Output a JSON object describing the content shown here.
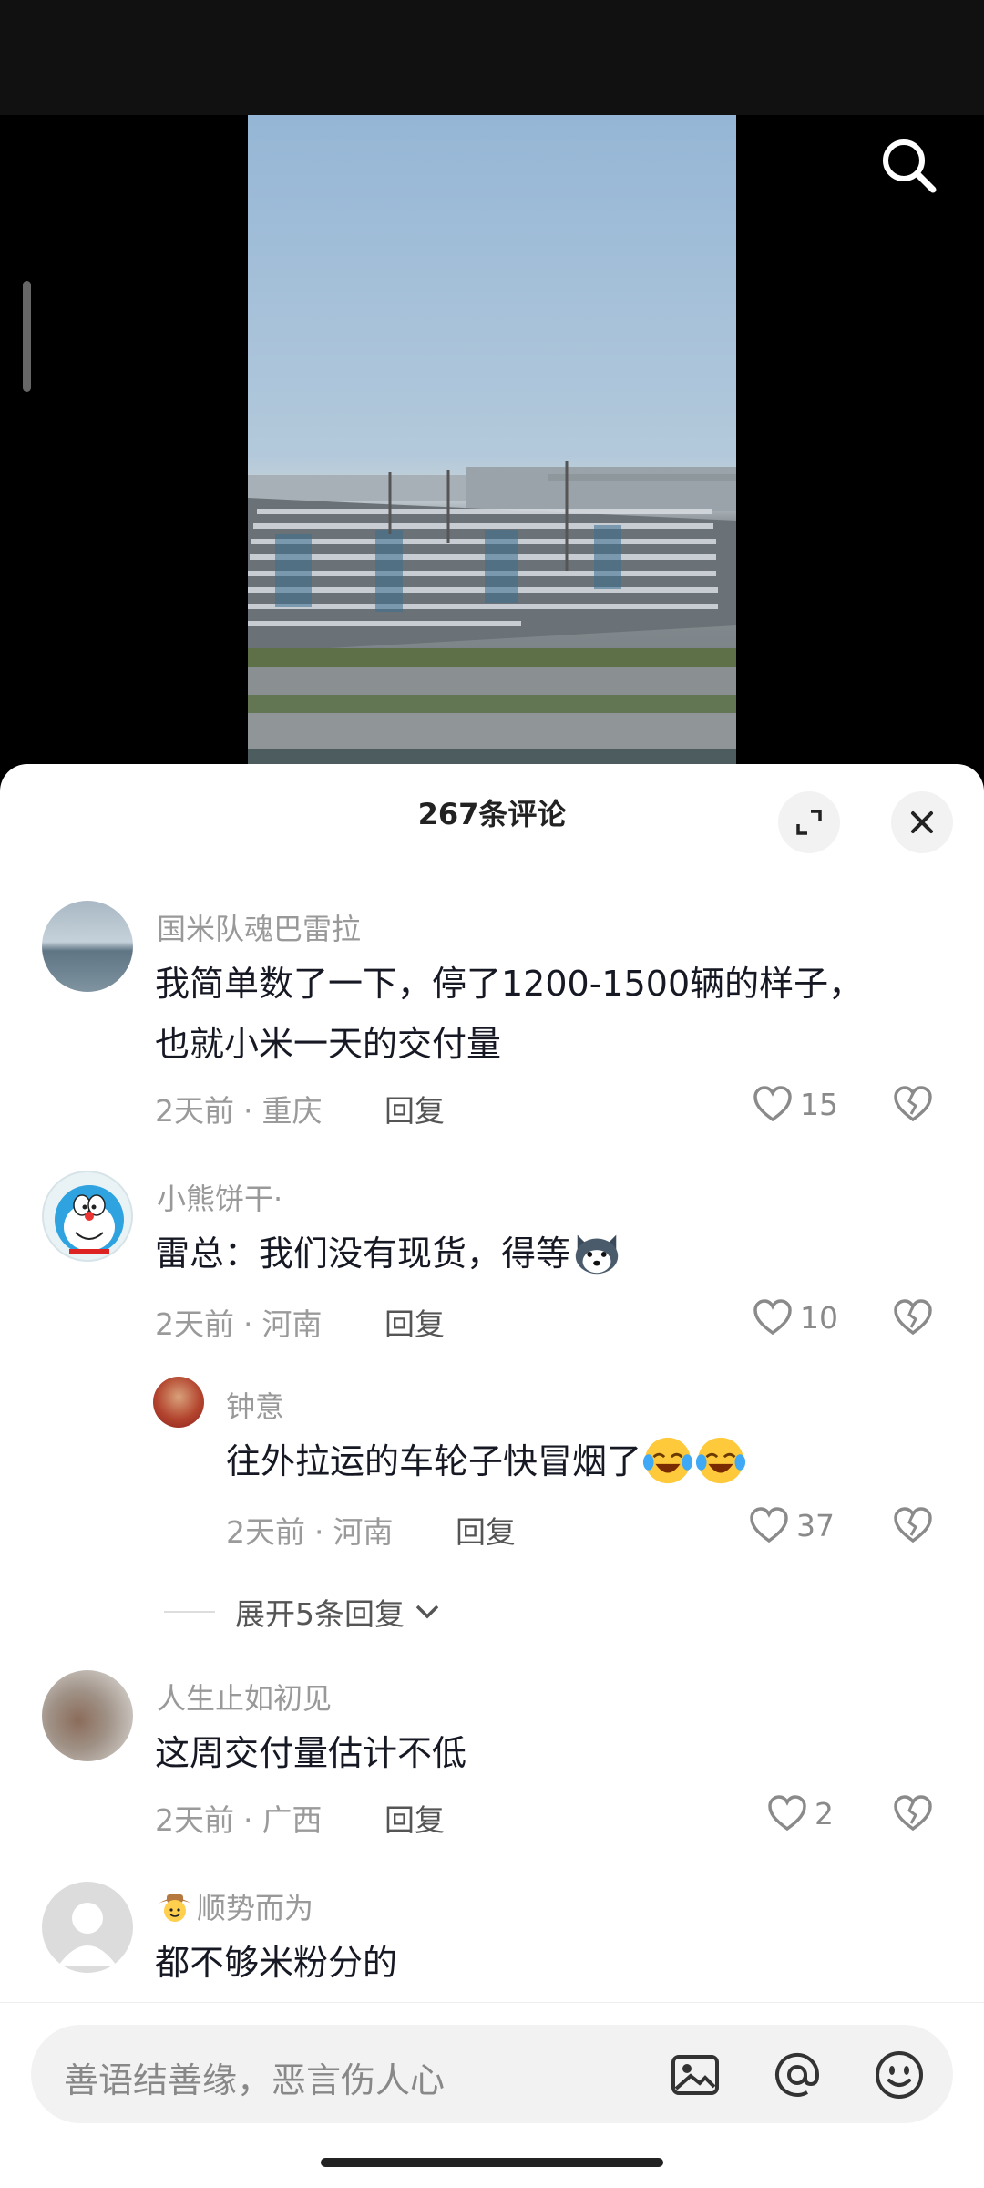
{
  "sheet": {
    "title": "267条评论"
  },
  "comments": [
    {
      "name": "国米队魂巴雷拉",
      "text_line1": "我简单数了一下，停了1200-1500辆的样子，",
      "text_line2": "也就小米一天的交付量",
      "time": "2天前",
      "location": "重庆",
      "reply": "回复",
      "likes": "15"
    },
    {
      "name": "小熊饼干·",
      "text": "雷总：我们没有现货，得等",
      "time": "2天前",
      "location": "河南",
      "reply": "回复",
      "likes": "10"
    },
    {
      "name": "钟意",
      "text": "往外拉运的车轮子快冒烟了",
      "time": "2天前",
      "location": "河南",
      "reply": "回复",
      "likes": "37"
    },
    {
      "name": "人生止如初见",
      "text": "这周交付量估计不低",
      "time": "2天前",
      "location": "广西",
      "reply": "回复",
      "likes": "2"
    },
    {
      "name": "顺势而为",
      "text": "都不够米粉分的"
    }
  ],
  "expand_replies": "展开5条回复",
  "input": {
    "placeholder": "善语结善缘，恶言伤人心"
  },
  "icons": {
    "search": "search-icon",
    "expand": "expand-icon",
    "close": "close-icon",
    "like": "heart-icon",
    "dislike": "broken-heart-icon",
    "image": "image-icon",
    "mention": "at-icon",
    "emoji": "emoji-icon"
  }
}
